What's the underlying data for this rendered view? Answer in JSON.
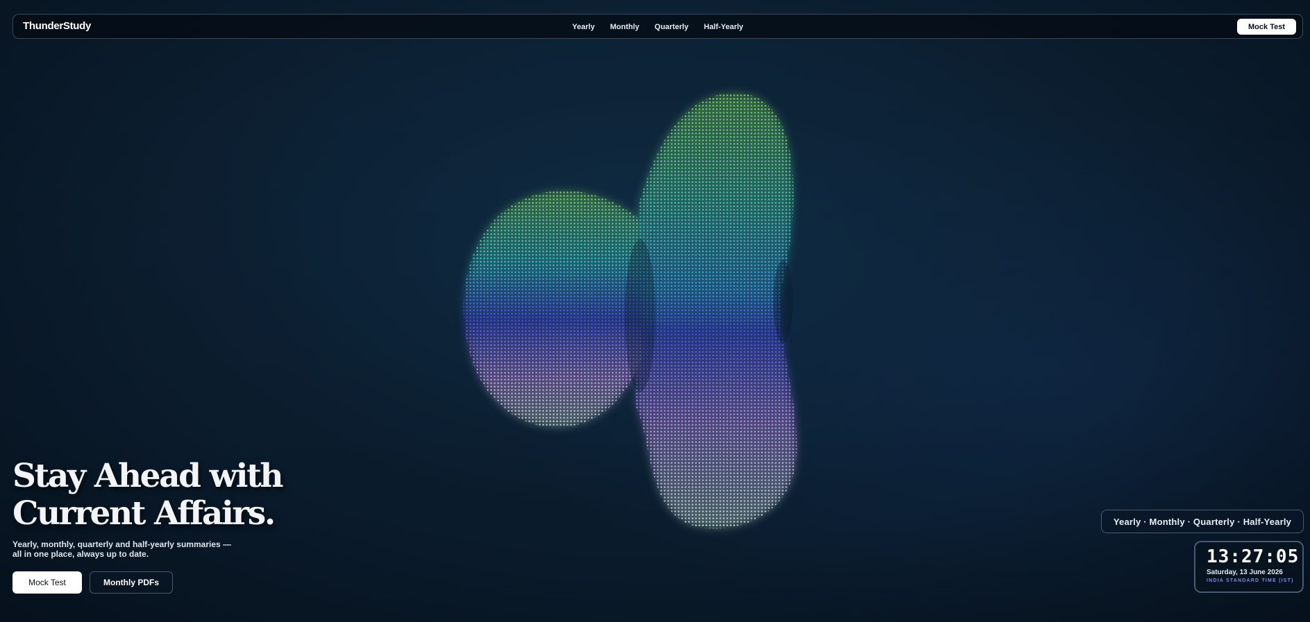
{
  "nav": {
    "brand": "ThunderStudy",
    "links": [
      "Yearly",
      "Monthly",
      "Quarterly",
      "Half-Yearly"
    ],
    "cta": "Mock Test"
  },
  "hero": {
    "title_line1": "Stay Ahead with",
    "title_line2": "Current Affairs.",
    "subtitle_line1": "Yearly, monthly, quarterly and half-yearly summaries —",
    "subtitle_line2": "all in one place, always up to date.",
    "primary_button": "Mock Test",
    "secondary_button": "Monthly PDFs"
  },
  "periods_pill": "Yearly · Monthly · Quarterly · Half-Yearly",
  "clock": {
    "time": "13:27:05",
    "date": "Saturday, 13 June 2026",
    "zone": "INDIA STANDARD TIME (IST)"
  },
  "colors": {
    "background": "#0b1c2d",
    "shape_green": "#7ccf5a",
    "shape_cyan": "#39c8c8",
    "shape_blue": "#4a4ee0",
    "shape_violet": "#c89ae8",
    "clock_zone": "#7c8fd8"
  }
}
